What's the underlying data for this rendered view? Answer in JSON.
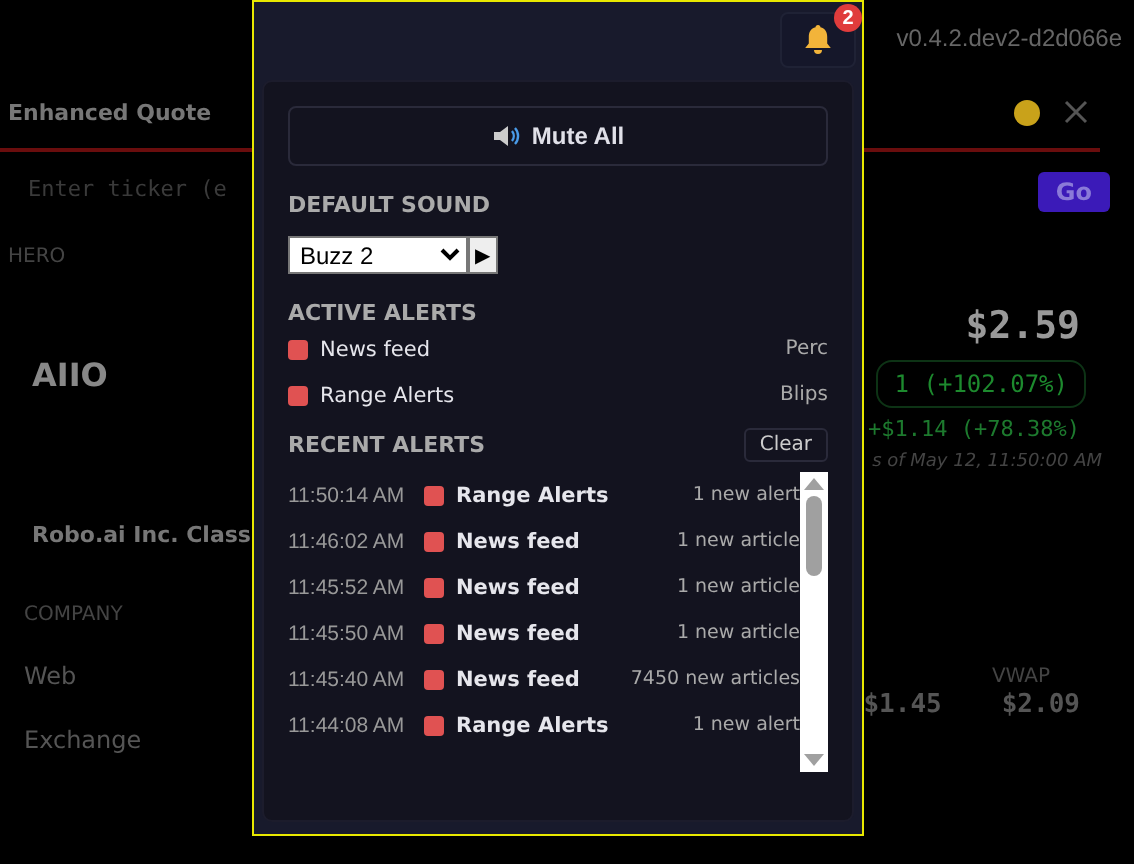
{
  "background": {
    "version": "v0.4.2.dev2-d2d066e",
    "panel_title": "Enhanced Quote",
    "ticker_placeholder": "Enter ticker (e",
    "go_button": "Go",
    "section_label": "HERO",
    "symbol": "AIIO",
    "company_name": "Robo.ai Inc. Class",
    "company_label": "COMPANY",
    "field_labels": [
      "Web",
      "Exchange"
    ],
    "price": "$2.59",
    "change": "1 (+102.07%)",
    "after_hours": "+$1.14 (+78.38%)",
    "as_of": "s of May 12, 11:50:00 AM",
    "vwap_label": "VWAP",
    "low_value": "$1.45",
    "vwap_value": "$2.09"
  },
  "notifications": {
    "badge": "2",
    "mute_button": "Mute All",
    "default_sound_title": "DEFAULT SOUND",
    "sound_value": "Buzz 2",
    "play_button": "▶",
    "active_title": "ACTIVE ALERTS",
    "active_alerts": [
      {
        "name": "News feed",
        "sound": "Perc",
        "color": "#e05252"
      },
      {
        "name": "Range Alerts",
        "sound": "Blips",
        "color": "#e05252"
      }
    ],
    "recent_title": "RECENT ALERTS",
    "clear_button": "Clear",
    "recent_alerts": [
      {
        "time": "11:50:14 AM",
        "name": "Range Alerts",
        "detail": "1 new alert",
        "color": "#e05252"
      },
      {
        "time": "11:46:02 AM",
        "name": "News feed",
        "detail": "1 new article",
        "color": "#e05252"
      },
      {
        "time": "11:45:52 AM",
        "name": "News feed",
        "detail": "1 new article",
        "color": "#e05252"
      },
      {
        "time": "11:45:50 AM",
        "name": "News feed",
        "detail": "1 new article",
        "color": "#e05252"
      },
      {
        "time": "11:45:40 AM",
        "name": "News feed",
        "detail": "7450 new articles",
        "color": "#e05252"
      },
      {
        "time": "11:44:08 AM",
        "name": "Range Alerts",
        "detail": "1 new alert",
        "color": "#e05252"
      }
    ]
  }
}
